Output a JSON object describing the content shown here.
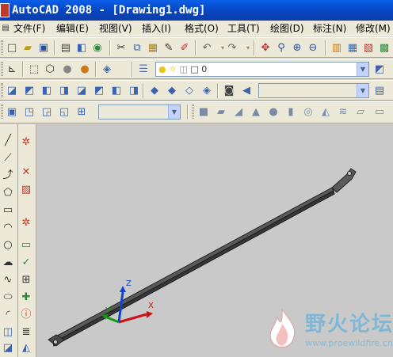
{
  "window": {
    "title": "AutoCAD 2008 - [Drawing1.dwg]"
  },
  "menu": {
    "items": [
      "文件(F)",
      "编辑(E)",
      "视图(V)",
      "插入(I)",
      "格式(O)",
      "工具(T)",
      "绘图(D)",
      "标注(N)",
      "修改(M)"
    ]
  },
  "layers": {
    "current_layer": "0"
  },
  "canvas": {
    "ucs_labels": {
      "x": "X",
      "y": "Y",
      "z": "Z"
    }
  },
  "watermark": {
    "title": "野火论坛",
    "url": "www.proewildfire.cn"
  },
  "icons": {
    "standard": [
      "new-icon",
      "open-icon",
      "save-icon",
      "plot-icon",
      "preview-icon",
      "publish-icon",
      "cut-icon",
      "copy-icon",
      "paste-icon",
      "brush-icon",
      "match-properties-icon",
      "undo-icon",
      "redo-icon",
      "pan-icon",
      "zoom-realtime-icon",
      "zoom-window-icon",
      "zoom-previous-icon"
    ],
    "left_draw": [
      "line-icon",
      "construction-line-icon",
      "polyline-icon",
      "polygon-icon",
      "rectangle-icon",
      "arc-icon",
      "circle-icon",
      "revision-cloud-icon",
      "spline-icon",
      "ellipse-icon",
      "ellipse-arc-icon",
      "insert-block-icon",
      "make-block-icon"
    ],
    "left_modify": [
      "gear-icon",
      "erase-icon",
      "hatch-icon",
      "gear-icon",
      "make-group-icon",
      "check-icon",
      "tolerance-icon",
      "add-icon",
      "info-icon",
      "multiline-text-icon",
      "linear-dimension-icon"
    ]
  },
  "colors": {
    "titlebar": "#0845c0",
    "canvas": "#c9c9c9",
    "model": "#3a3a3a",
    "ucs_x": "#cc1111",
    "ucs_y": "#119911",
    "ucs_z": "#1144cc"
  }
}
